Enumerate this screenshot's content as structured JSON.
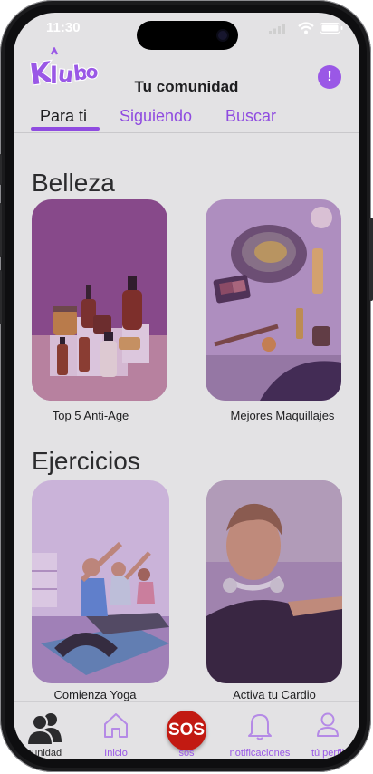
{
  "status_bar": {
    "time": "11:30"
  },
  "header": {
    "logo_text": "Klubo",
    "title": "Tu comunidad",
    "alert_symbol": "!"
  },
  "tabs": [
    {
      "label": "Para ti",
      "active": true
    },
    {
      "label": "Siguiendo",
      "active": false
    },
    {
      "label": "Buscar",
      "active": false
    }
  ],
  "sections": [
    {
      "title": "Belleza",
      "cards": [
        {
          "label": "Top 5 Anti-Age"
        },
        {
          "label": "Mejores Maquillajes"
        }
      ]
    },
    {
      "title": "Ejercicios",
      "cards": [
        {
          "label": "Comienza Yoga"
        },
        {
          "label": "Activa tu Cardio"
        }
      ]
    }
  ],
  "bottom_nav": {
    "community": "omunidad",
    "home": "Inicio",
    "sos_button": "SOS",
    "sos": "sos",
    "notifications": "notificaciones",
    "profile": "tú perfil"
  },
  "colors": {
    "accent": "#8f4be0",
    "sos": "#c21a12",
    "background": "#e3e2e4"
  }
}
